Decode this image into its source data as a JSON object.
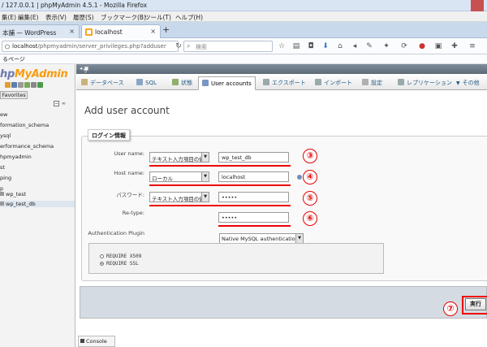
{
  "window": {
    "title": "/ 127.0.0.1 | phpMyAdmin 4.5.1 - Mozilla Firefox"
  },
  "menubar": {
    "items": [
      "集(E)",
      "編集(E)",
      "表示(V)",
      "履歴(S)",
      "ブックマーク(B)",
      "ツール(T)",
      "ヘルプ(H)"
    ]
  },
  "tabs": [
    {
      "label": "本舗 — WordPress"
    },
    {
      "label": "localhost"
    }
  ],
  "navbar": {
    "url_host": "localhost",
    "url_path": "/phpmyadmin/server_privileges.php?adduser=1&",
    "search_placeholder": "検索"
  },
  "bookmarks": {
    "label": "るページ"
  },
  "sidebar": {
    "logo_prefix": "hp",
    "logo_brand": "MyAdmin",
    "favorites_label": "Favorites",
    "databases": [
      "ew",
      "formation_schema",
      "ysql",
      "erformance_schema",
      "hpmyadmin",
      "st",
      "ping",
      "p",
      "wp_test",
      "wp_test_db"
    ]
  },
  "serverbar": {
    "label": "サーバ"
  },
  "topmenu": {
    "tabs": [
      "データベース",
      "SQL",
      "状態",
      "User accounts",
      "エクスポート",
      "インポート",
      "設定",
      "レプリケーション",
      "その他"
    ]
  },
  "page": {
    "title": "Add user account"
  },
  "form": {
    "legend": "ログイン情報",
    "username": {
      "label": "User name:",
      "select": "テキスト入力項目の値を",
      "value": "wp_test_db",
      "badge": "③"
    },
    "hostname": {
      "label": "Host name:",
      "select": "ローカル",
      "value": "localhost",
      "badge": "④"
    },
    "password": {
      "label": "パスワード:",
      "select": "テキスト入力項目の値を",
      "value": "•••••",
      "badge": "⑤"
    },
    "retype": {
      "label": "Re-type:",
      "value": "•••••",
      "badge": "⑥"
    },
    "auth_plugin": {
      "label": "Authentication Plugin",
      "select": "Native MySQL authentication"
    },
    "ssl": [
      "REQUIRE X509",
      "REQUIRE SSL"
    ]
  },
  "footer": {
    "go_label": "実行",
    "badge": "⑦"
  },
  "console": {
    "label": "Console"
  },
  "colors": {
    "annotation_red": "#e40000",
    "accent_blue": "#235a81",
    "logo_orange": "#f89c0e"
  }
}
